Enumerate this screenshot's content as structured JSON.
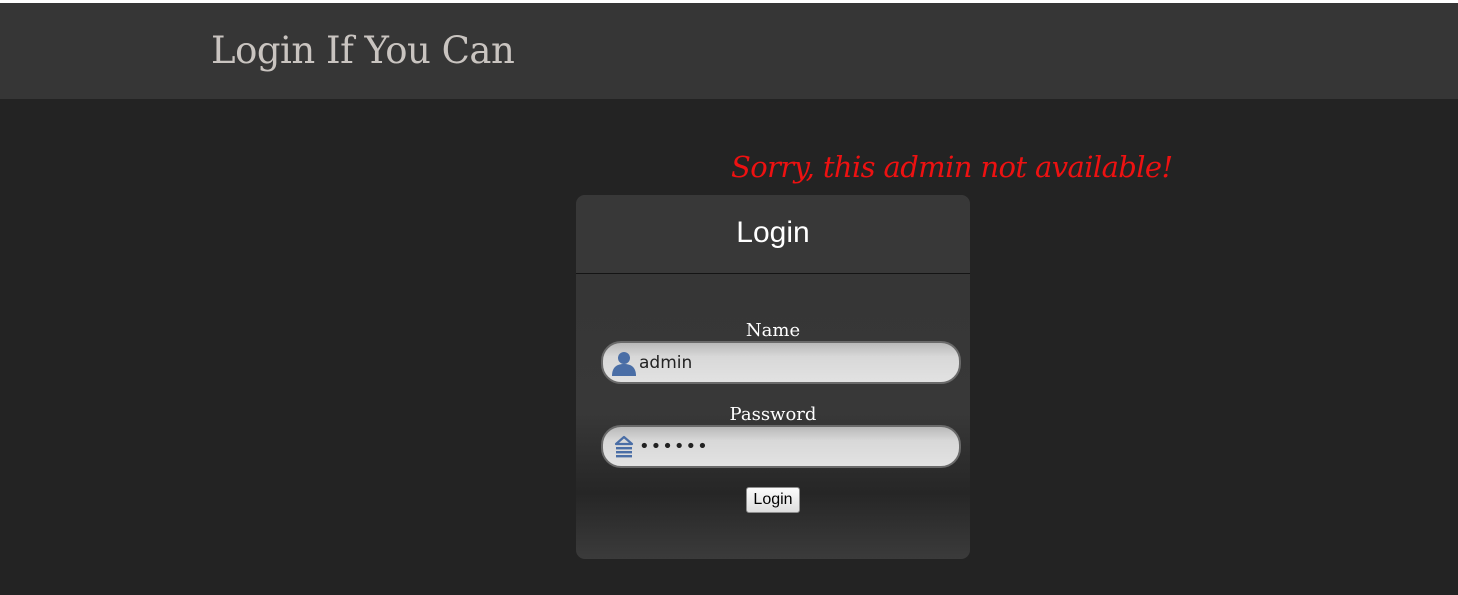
{
  "header": {
    "title": "Login If You Can"
  },
  "error": {
    "message": "Sorry, this admin not available!",
    "color": "#ee1111"
  },
  "login_panel": {
    "title": "Login",
    "name_label": "Name",
    "name_value": "admin",
    "name_icon": "user-icon",
    "password_label": "Password",
    "password_value": "••••••",
    "password_icon": "lock-icon",
    "submit_label": "Login"
  },
  "colors": {
    "page_background": "#232323",
    "header_background": "#363636",
    "icon_blue": "#4a6ea6"
  }
}
